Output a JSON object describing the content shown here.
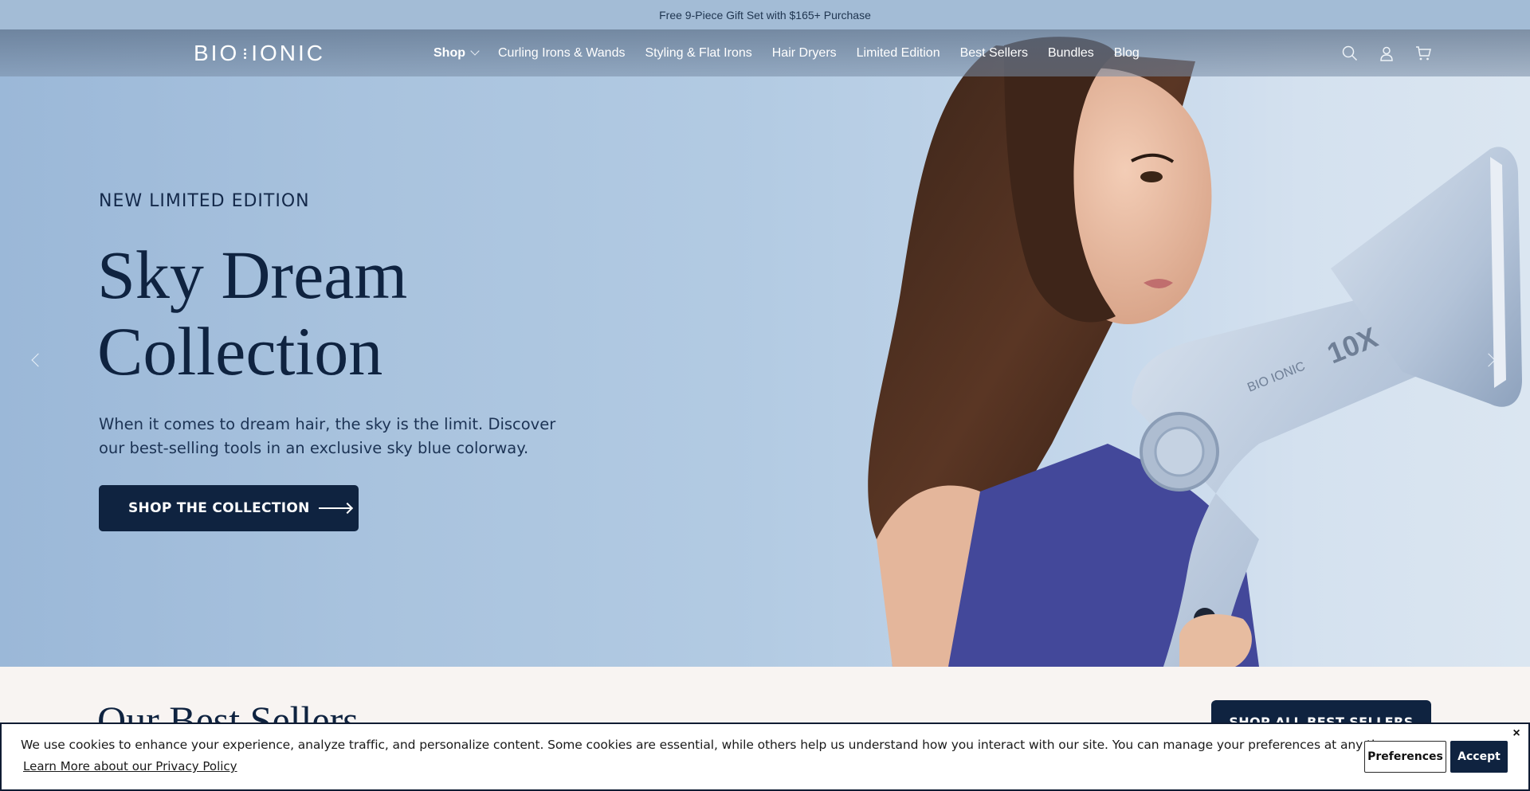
{
  "announcement": {
    "text": "Free 9-Piece Gift Set with $165+ Purchase"
  },
  "header": {
    "logo_text": "BIO IONIC",
    "nav": [
      {
        "label": "Shop",
        "has_dropdown": true
      },
      {
        "label": "Curling Irons & Wands"
      },
      {
        "label": "Styling & Flat Irons"
      },
      {
        "label": "Hair Dryers"
      },
      {
        "label": "Limited Edition"
      },
      {
        "label": "Best Sellers"
      },
      {
        "label": "Bundles"
      },
      {
        "label": "Blog"
      }
    ],
    "icons": [
      "search-icon",
      "account-icon",
      "cart-icon"
    ]
  },
  "hero": {
    "eyebrow": "NEW LIMITED EDITION",
    "headline_line1": "Sky Dream",
    "headline_line2": "Collection",
    "description": "When it comes to dream hair, the sky is the limit. Discover our best-selling tools in an exclusive sky blue colorway.",
    "cta_label": "SHOP THE COLLECTION",
    "dryer_brand_text": "BIO IONIC",
    "dryer_model_text": "10X"
  },
  "best_sellers": {
    "title": "Our Best Sellers",
    "button_label": "SHOP ALL BEST SELLERS"
  },
  "cookie_banner": {
    "message": "We use cookies to enhance your experience, analyze traffic, and personalize content. Some cookies are essential, while others help us understand how you interact with our site. You can manage your preferences at any time.",
    "link_text": "Learn More about our Privacy Policy",
    "preferences_label": "Preferences",
    "accept_label": "Accept",
    "close_label": "×"
  },
  "colors": {
    "navy": "#0f2340",
    "sky": "#a9c3de",
    "announce_bg": "#a3bcd6"
  }
}
